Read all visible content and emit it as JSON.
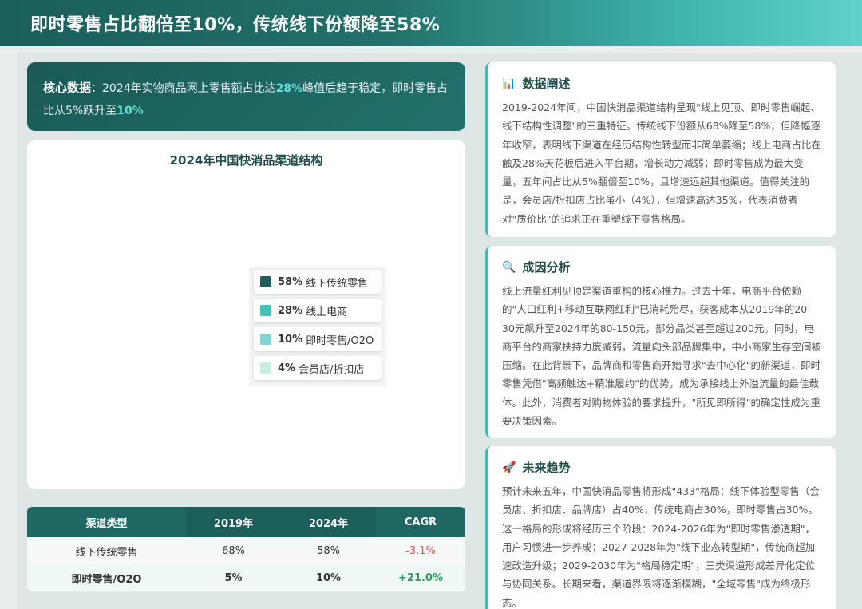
{
  "header": {
    "title": "即时零售占比翻倍至10%，传统线下份额降至58%"
  },
  "core": {
    "label": "核心数据",
    "sep": "：",
    "text1": "2024年实物商品网上零售额占比达",
    "hl1": "28%",
    "text2": "峰值后趋于稳定，即时零售占比从5%跃升至",
    "hl2": "10%"
  },
  "chart_data": {
    "type": "pie",
    "title": "2024年中国快消品渠道结构",
    "slices": [
      {
        "label": "线下传统零售",
        "value": 58,
        "color": "#1f5f5b"
      },
      {
        "label": "线上电商",
        "value": 28,
        "color": "#44c2b8"
      },
      {
        "label": "即时零售/O2O",
        "value": 10,
        "color": "#7fd6d0"
      },
      {
        "label": "会员店/折扣店",
        "value": 4,
        "color": "#c9ebe6"
      }
    ],
    "legend_labels": [
      "58% 线下传统零售",
      "28% 线上电商",
      "10% 即时零售/O2O",
      "4% 会员店/折扣店"
    ]
  },
  "legend": [
    {
      "pct": "58%",
      "label": "线下传统零售",
      "color": "#1f5f5b"
    },
    {
      "pct": "28%",
      "label": "线上电商",
      "color": "#44c2b8"
    },
    {
      "pct": "10%",
      "label": "即时零售/O2O",
      "color": "#7fd6d0"
    },
    {
      "pct": "4%",
      "label": "会员店/折扣店",
      "color": "#c9ebe6"
    }
  ],
  "table": {
    "headers": [
      "渠道类型",
      "2019年",
      "2024年",
      "CAGR"
    ],
    "rows": [
      [
        "线下传统零售",
        "68%",
        "58%",
        "-3.1%"
      ],
      [
        "即时零售/O2O",
        "5%",
        "10%",
        "+21.0%"
      ]
    ]
  },
  "cards": [
    {
      "icon": "bar-chart-icon",
      "glyph": "📊",
      "title": "数据阐述",
      "body": "2019-2024年间，中国快消品渠道结构呈现\"线上见顶、即时零售崛起、线下结构性调整\"的三重特征。传统线下份额从68%降至58%，但降幅逐年收窄，表明线下渠道在经历结构性转型而非简单萎缩；线上电商占比在触及28%天花板后进入平台期，增长动力减弱；即时零售成为最大变量，五年间占比从5%翻倍至10%，且增速远超其他渠道。值得关注的是，会员店/折扣店占比虽小（4%），但增速高达35%，代表消费者对\"质价比\"的追求正在重塑线下零售格局。"
    },
    {
      "icon": "magnifier-icon",
      "glyph": "🔍",
      "title": "成因分析",
      "body": "线上流量红利见顶是渠道重构的核心推力。过去十年，电商平台依赖的\"人口红利+移动互联网红利\"已消耗殆尽，获客成本从2019年的20-30元飙升至2024年的80-150元，部分品类甚至超过200元。同时，电商平台的商家扶持力度减弱，流量向头部品牌集中，中小商家生存空间被压缩。在此背景下，品牌商和零售商开始寻求\"去中心化\"的新渠道，即时零售凭借\"高频触达+精准履约\"的优势，成为承接线上外溢流量的最佳载体。此外，消费者对购物体验的要求提升，\"所见即所得\"的确定性成为重要决策因素。"
    },
    {
      "icon": "rocket-icon",
      "glyph": "🚀",
      "title": "未来趋势",
      "body": "预计未来五年，中国快消品零售将形成\"433\"格局：线下体验型零售（会员店、折扣店、品牌店）占40%，传统电商占30%，即时零售占30%。这一格局的形成将经历三个阶段：2024-2026年为\"即时零售渗透期\"，用户习惯进一步养成；2027-2028年为\"线下业态转型期\"，传统商超加速改造升级；2029-2030年为\"格局稳定期\"，三类渠道形成差异化定位与协同关系。长期来看，渠道界限将逐渐模糊，\"全域零售\"成为终极形态。"
    }
  ]
}
